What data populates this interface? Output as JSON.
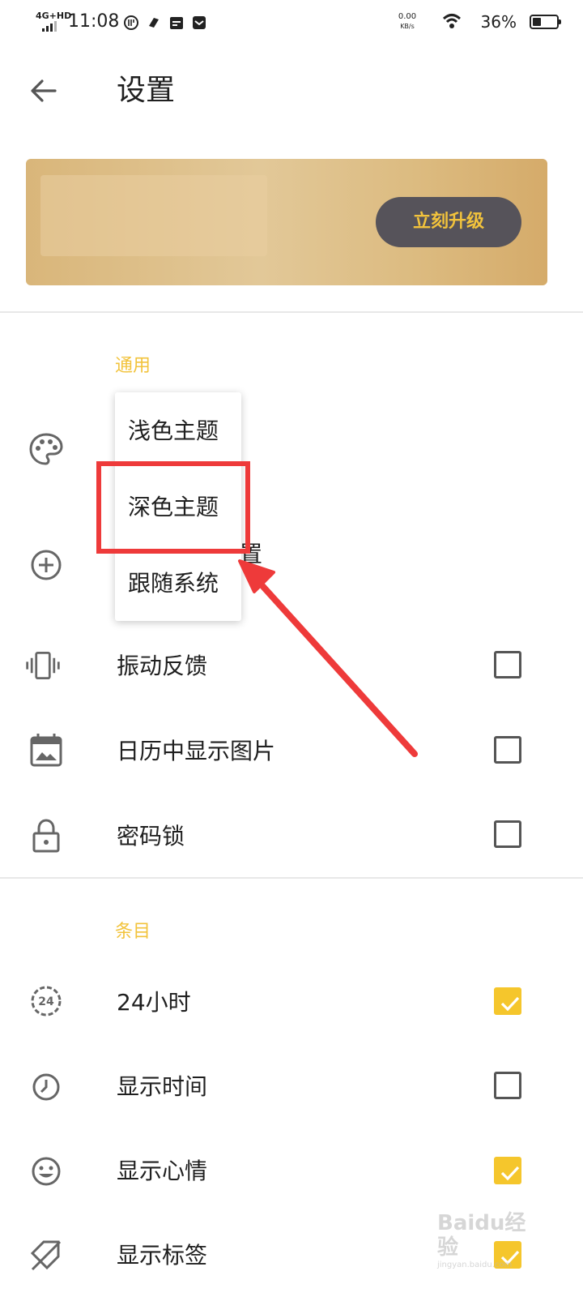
{
  "status_bar": {
    "network": "4G+HD",
    "time": "11:08",
    "speed_value": "0.00",
    "speed_unit": "KB/s",
    "battery_percent": "36%"
  },
  "header": {
    "title": "设置"
  },
  "banner": {
    "upgrade_label": "立刻升级"
  },
  "sections": {
    "general": {
      "title": "通用",
      "partial_label": "置",
      "rows": [
        {
          "label": "振动反馈",
          "icon": "vibrate-icon",
          "checked": false
        },
        {
          "label": "日历中显示图片",
          "icon": "calendar-image-icon",
          "checked": false
        },
        {
          "label": "密码锁",
          "icon": "lock-icon",
          "checked": false
        }
      ]
    },
    "items": {
      "title": "条目",
      "rows": [
        {
          "label": "24小时",
          "icon": "clock-24-icon",
          "checked": true
        },
        {
          "label": "显示时间",
          "icon": "clock-icon",
          "checked": false
        },
        {
          "label": "显示心情",
          "icon": "smiley-icon",
          "checked": true
        },
        {
          "label": "显示标签",
          "icon": "tag-off-icon",
          "checked": true
        }
      ]
    }
  },
  "theme_menu": {
    "options": [
      "浅色主题",
      "深色主题",
      "跟随系统"
    ]
  },
  "colors": {
    "accent": "#f5c62c",
    "annotation": "#ee3a3a",
    "upgrade_button": "#56535a"
  },
  "watermark": {
    "text": "Baidu经验",
    "subtext": "jingyan.baidu.com"
  }
}
